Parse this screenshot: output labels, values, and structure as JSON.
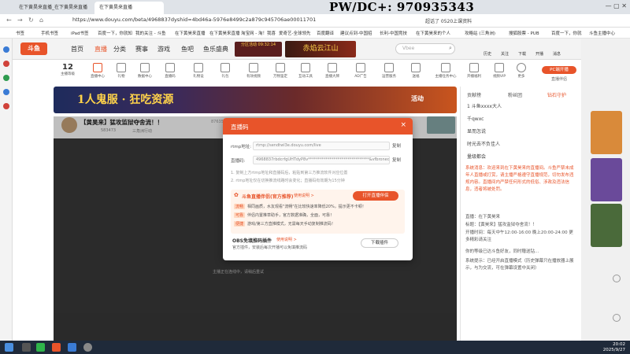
{
  "browser": {
    "tabs": [
      {
        "label": "在下黄昊来直播_在下黄昊来直播"
      },
      {
        "label": "在下黄昊来直播"
      }
    ],
    "url": "https://www.douyu.com/beta/4968837dyshid=4bd46a-5976e8499c2a879c945706ae00011701",
    "right_tab": "超话了 0520上课资料",
    "bookmarks": [
      "书签",
      "手机书签",
      "iPad书签",
      "百度一下，你就知",
      "我的关注 - 斗鱼",
      "在下黄昊来直播",
      "在下黄昊来直播",
      "淘宝网 - 淘！我喜",
      "爱奇艺-全球领先",
      "百度翻译",
      "建议点到-中国招",
      "长利-中国竞技",
      "在下黄昊来的个人",
      "攻略站 (三角洲)",
      "搜狐股票 - PUB",
      "百度一下，你就",
      "斗鱼主播中心"
    ]
  },
  "watermark": "PW/DC+:  970935343",
  "site": {
    "logo": "斗鱼",
    "nav": [
      "首页",
      "直播",
      "分类",
      "赛事",
      "游戏",
      "鱼吧",
      "鱼乐盛典"
    ],
    "banner_small": "分区活动 09:32:14",
    "header_promo": "赤焰云江山",
    "search_placeholder": "Vbee",
    "header_right": [
      "历史",
      "关注",
      "下载",
      "开播",
      "消息"
    ]
  },
  "toolbar": {
    "level": "12",
    "level_label": "主播等级",
    "items": [
      "直播中心",
      "礼物",
      "数据中心",
      "直播码",
      "礼物设",
      "礼包",
      "有效视频",
      "万物鉴定",
      "互动工具",
      "直播大牌",
      "AD广告",
      "运营服务",
      "送福",
      "主播任务中心",
      "开播福利",
      "视频VIP",
      "更多"
    ],
    "pc_btn": "PC端开播",
    "extra_label": "直播伴侣"
  },
  "banner": {
    "text": "1人鬼服 · 狂吃资源",
    "suffix": "活动"
  },
  "room": {
    "title": "【黄昊来】猛攻监狱夺舍流！！",
    "follows": "87635",
    "follow_btn": "关注",
    "hot": "583473",
    "tag": "三角洲行动"
  },
  "chat": {
    "tabs": [
      "贡献榜",
      "粉丝团",
      "钻石守护"
    ],
    "ranks": [
      {
        "name": "斗鱼xxxx大人",
        "value": "1"
      },
      {
        "name": "千qwxc",
        "value": ""
      },
      {
        "name": "显而怎说",
        "value": ""
      },
      {
        "name": "时光去不负佳人",
        "value": ""
      },
      {
        "name": "量级都会",
        "value": ""
      }
    ],
    "notice": "系统消息：欢迎来到在下黄昊来的直播间。斗鱼严禁未成年人直播或打赏，请主播严格遵守直播规范，切勿发布违规内容。直播间内严禁任何形式的低俗、涉政及违法信息，违者将被处罚。",
    "room_title_line": "直播：在下黄昊来",
    "room_title_line2": "标题：【黄昊来】猛攻监狱夺舍流！！",
    "schedule": "开播时间：每天中午12:00-16:00 晚上20:00-24:00 更多精彩请关注",
    "gift_line": "你的等级已达斗鱼好友，同时赠送钻...",
    "sys_line": "系统提示：已经开启直播模式（历史弹幕只在播放器上展示，与为交流，可在弹幕设置中关闭）",
    "bottom_notice": "主播正在连线中，请稍后重试"
  },
  "modal": {
    "title": "直播码",
    "rtmp_label": "rtmp地址:",
    "rtmp_value": "rtmp://sendtwl3e.douyu.com/live",
    "code_label": "直播码:",
    "code_value": "4968837rbdcrfgUHTdyP8v*******************************&vfbronecognition=0",
    "copy": "复制",
    "hint1": "1. 复制上方rtmp地址和直播码后，粘贴到第三方推流软件对应位置",
    "hint2": "2. rtmp地址仅在切换推流线路时会变化；直播码有效期为15分钟",
    "promo_title": "斗鱼直播伴侣(官方推荐)",
    "promo_link": "使用说明 >",
    "open_btn": "打开直播伴侣",
    "promo_lines": [
      {
        "tag": "流畅",
        "text": "相同画质，水友观看\"流畅\"在比较快速率降低20%，提示更不卡顿！"
      },
      {
        "tag": "可靠",
        "text": "伴侣内置推草助手，官方数据准确，全面，可靠！"
      },
      {
        "tag": "便捷",
        "text": "游戏/第三方直推模式，无需每天手动复制推流码！"
      }
    ],
    "obs_title": "OBS免填推码插件",
    "obs_link": "使用说明 >",
    "obs_desc": "官方插件，安装后每次开播可以免填推流码",
    "download_btn": "下载插件"
  },
  "taskbar": {
    "time": "20:02",
    "date": "2025/9/27"
  },
  "colors": {
    "accent": "#e8542a",
    "modal_header": "#e8542a",
    "promo_bg": "#fff4ec"
  }
}
